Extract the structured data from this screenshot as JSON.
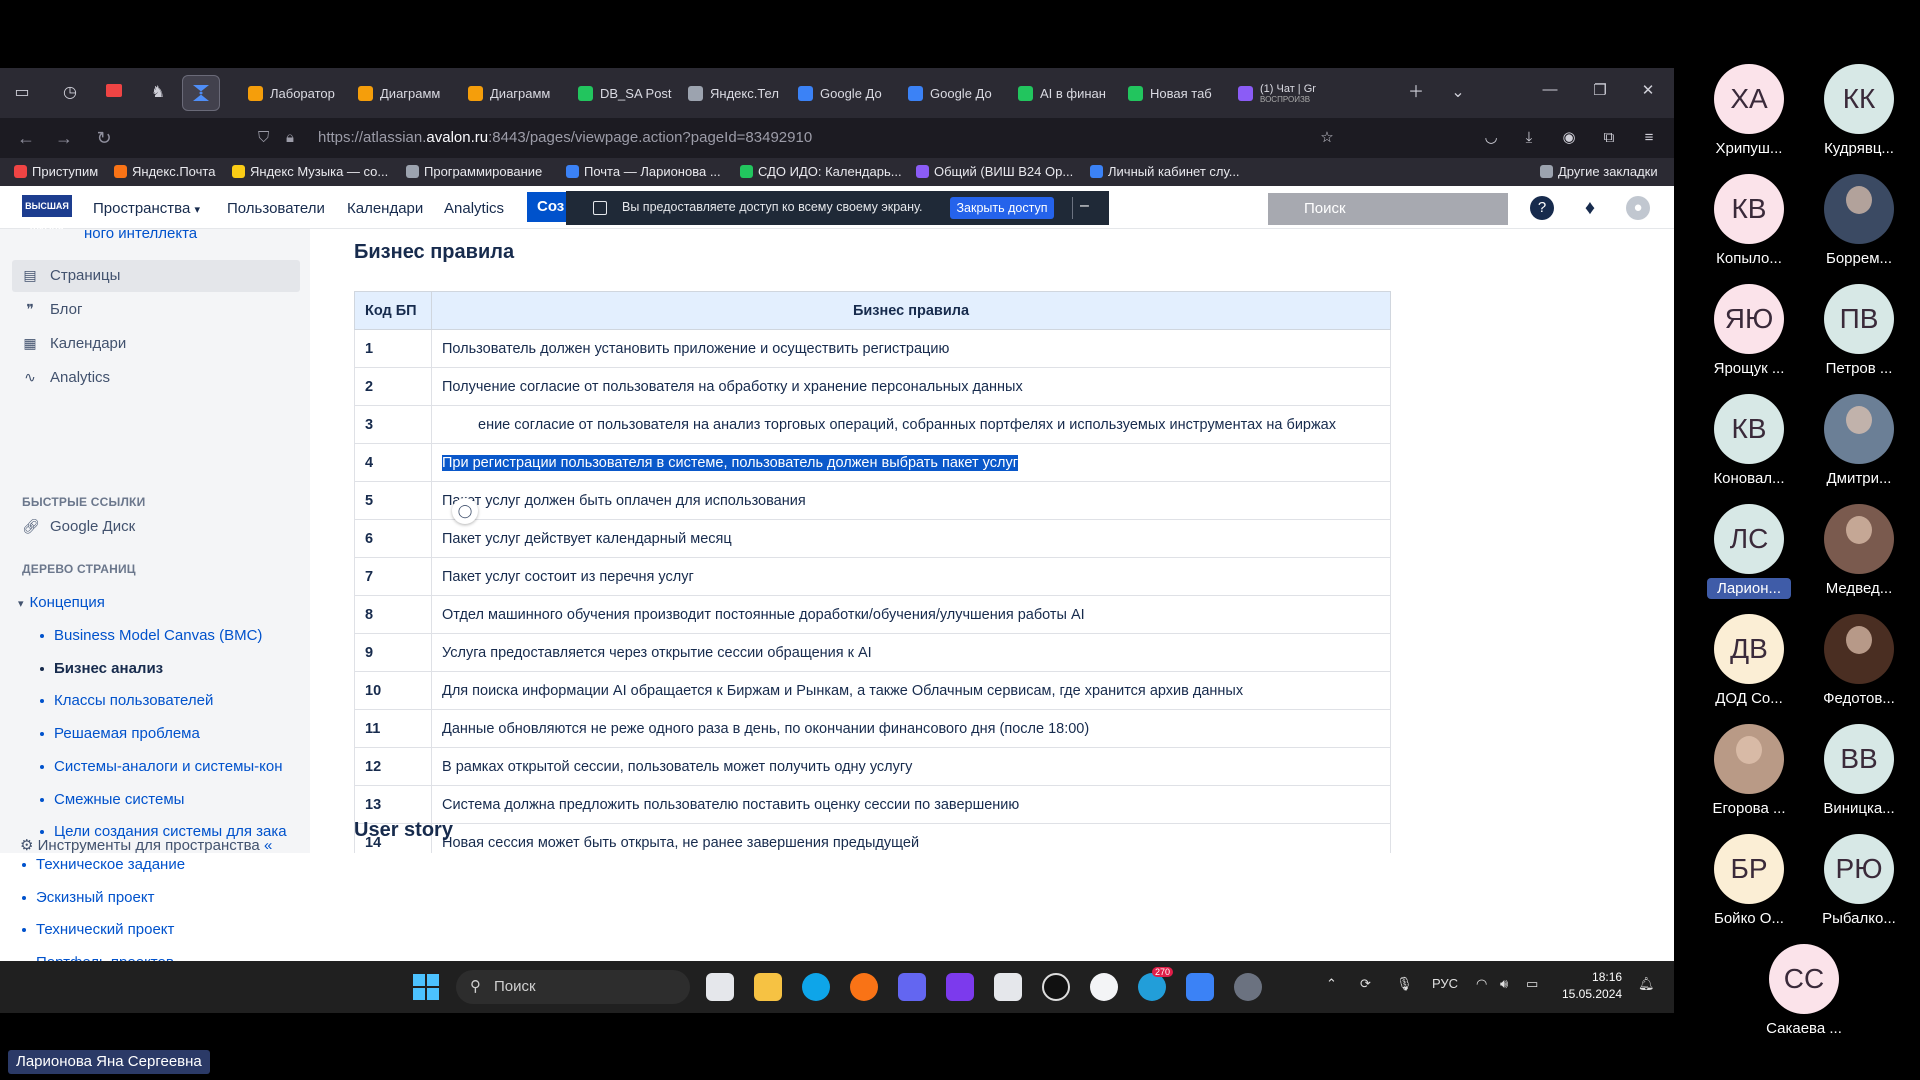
{
  "browser": {
    "tabs": [
      {
        "label": "Лаборатор",
        "color": "#f59e0b"
      },
      {
        "label": "Диаграмм",
        "color": "#f59e0b"
      },
      {
        "label": "Диаграмм",
        "color": "#f59e0b"
      },
      {
        "label": "DB_SA Post",
        "color": "#22c55e"
      },
      {
        "label": "Яндекс.Тел",
        "color": "#9ca3af"
      },
      {
        "label": "Google До",
        "color": "#3b82f6"
      },
      {
        "label": "Google До",
        "color": "#3b82f6"
      },
      {
        "label": "AI в финан",
        "color": "#22c55e"
      },
      {
        "label": "Новая таб",
        "color": "#22c55e"
      },
      {
        "label": "(1) Чат | Gr",
        "color": "#8b5cf6"
      }
    ],
    "tab_audio_label": "ВОСПРОИЗВ",
    "url_prefix": "https://atlassian.",
    "url_domain": "avalon.ru",
    "url_suffix": ":8443/pages/viewpage.action?pageId=83492910",
    "bookmarks": [
      {
        "label": "Приступим",
        "color": "#ef4444"
      },
      {
        "label": "Яндекс.Почта",
        "color": "#f97316"
      },
      {
        "label": "Яндекс Музыка — со...",
        "color": "#facc15"
      },
      {
        "label": "Программирование",
        "color": "#9ca3af"
      },
      {
        "label": "Почта — Ларионова ...",
        "color": "#3b82f6"
      },
      {
        "label": "СДО ИДО: Календарь...",
        "color": "#22c55e"
      },
      {
        "label": "Общий (ВИШ В24 Ор...",
        "color": "#8b5cf6"
      },
      {
        "label": "Личный кабинет слу...",
        "color": "#3b82f6"
      },
      {
        "label": "Другие закладки",
        "color": "#9ca3af"
      }
    ]
  },
  "confluence": {
    "logo_text": "ВЫСШАЯ ШКОЛА",
    "menu": {
      "spaces": "Пространства",
      "users": "Пользователи",
      "calendars": "Календари",
      "analytics": "Analytics",
      "create": "Соз"
    },
    "search_placeholder": "Поиск",
    "share_banner": {
      "text": "Вы предоставляете доступ ко всему своему экрану.",
      "button": "Закрыть доступ",
      "minimize": "–"
    }
  },
  "sidebar": {
    "truncated_top": "ного интеллекта",
    "nav": [
      {
        "label": "Страницы",
        "icon": "pages-icon"
      },
      {
        "label": "Блог",
        "icon": "blog-icon"
      },
      {
        "label": "Календари",
        "icon": "calendar-icon"
      },
      {
        "label": "Analytics",
        "icon": "analytics-icon"
      }
    ],
    "quick_links_heading": "БЫСТРЫЕ ССЫЛКИ",
    "quick_links": [
      {
        "label": "Google Диск",
        "icon": "link-icon"
      }
    ],
    "tree_heading": "ДЕРЕВО СТРАНИЦ",
    "tree_root": "Концепция",
    "tree_children": [
      "Business Model Canvas (BMC)",
      "Бизнес анализ",
      "Классы пользователей",
      "Решаемая проблема",
      "Системы-аналоги и системы-кон",
      "Смежные системы",
      "Цели создания системы для зака"
    ],
    "tree_siblings": [
      "Техническое задание",
      "Эскизный проект",
      "Технический проект",
      "Портфель проектов"
    ],
    "footer": "Инструменты для пространства"
  },
  "page": {
    "title": "Бизнес правила",
    "table_headers": [
      "Код БП",
      "Бизнес правила"
    ],
    "rows": [
      {
        "code": "1",
        "rule": "Пользователь должен установить приложение и осуществить регистрацию"
      },
      {
        "code": "2",
        "rule": "Получение согласие от пользователя на обработку и хранение персональных данных"
      },
      {
        "code": "3",
        "rule": "ение согласие от пользователя на анализ торговых операций, собранных портфелях и используемых инструментах на биржах"
      },
      {
        "code": "4",
        "rule": "При регистрации пользователя в системе, пользователь должен выбрать пакет услуг"
      },
      {
        "code": "5",
        "rule": "Пакет услуг должен быть оплачен для использования"
      },
      {
        "code": "6",
        "rule": "Пакет услуг действует календарный месяц"
      },
      {
        "code": "7",
        "rule": "Пакет услуг состоит из перечня услуг"
      },
      {
        "code": "8",
        "rule": "Отдел машинного обучения производит постоянные доработки/обучения/улучшения работы AI"
      },
      {
        "code": "9",
        "rule": "Услуга предоставляется через открытие сессии обращения к AI"
      },
      {
        "code": "10",
        "rule": "Для поиска информации AI обращается к Биржам и Рынкам, а также Облачным сервисам, где хранится архив данных"
      },
      {
        "code": "11",
        "rule": "Данные обновляются не реже одного раза в день, по окончании финансового дня (после 18:00)"
      },
      {
        "code": "12",
        "rule": "В рамках открытой сессии, пользователь может получить одну услугу"
      },
      {
        "code": "13",
        "rule": "Система должна предложить пользователю поставить оценку сессии по завершению"
      },
      {
        "code": "14",
        "rule": "Новая сессия может быть открыта, не ранее завершения предыдущей"
      }
    ],
    "next_heading": "User story"
  },
  "taskbar": {
    "search_label": "Поиск",
    "lang": "РУС",
    "time": "18:16",
    "date": "15.05.2024",
    "telegram_badge": "270"
  },
  "participants": [
    {
      "initials": "ХА",
      "name": "Хрипуш...",
      "color": "#fbe3ea"
    },
    {
      "initials": "КК",
      "name": "Кудрявц...",
      "color": "#d7e8e6"
    },
    {
      "initials": "КВ",
      "name": "Копыло...",
      "color": "#fbe3ea"
    },
    {
      "initials": "",
      "name": "Боррем...",
      "color": "#3b4a63"
    },
    {
      "initials": "ЯЮ",
      "name": "Ярощук ...",
      "color": "#fbe3ea"
    },
    {
      "initials": "ПВ",
      "name": "Петров ...",
      "color": "#d7e8e6"
    },
    {
      "initials": "КВ",
      "name": "Коновал...",
      "color": "#d7e8e6"
    },
    {
      "initials": "",
      "name": "Дмитри...",
      "color": "#6b7f96"
    },
    {
      "initials": "ЛС",
      "name": "Ларион...",
      "color": "#d7e8e6"
    },
    {
      "initials": "",
      "name": "Медвед...",
      "color": "#7a5a4e"
    },
    {
      "initials": "ДВ",
      "name": "ДОД Со...",
      "color": "#fbeed5"
    },
    {
      "initials": "",
      "name": "Федотов...",
      "color": "#4a2e22"
    },
    {
      "initials": "",
      "name": "Егорова ...",
      "color": "#b99a86"
    },
    {
      "initials": "ВВ",
      "name": "Виницка...",
      "color": "#d7e8e6"
    },
    {
      "initials": "БР",
      "name": "Бойко О...",
      "color": "#fbeed5"
    },
    {
      "initials": "РЮ",
      "name": "Рыбалко...",
      "color": "#d7e8e6"
    },
    {
      "initials": "СС",
      "name": "Сакаева ...",
      "color": "#fbe3ea"
    }
  ],
  "presenter": "Ларионова Яна Сергеевна"
}
